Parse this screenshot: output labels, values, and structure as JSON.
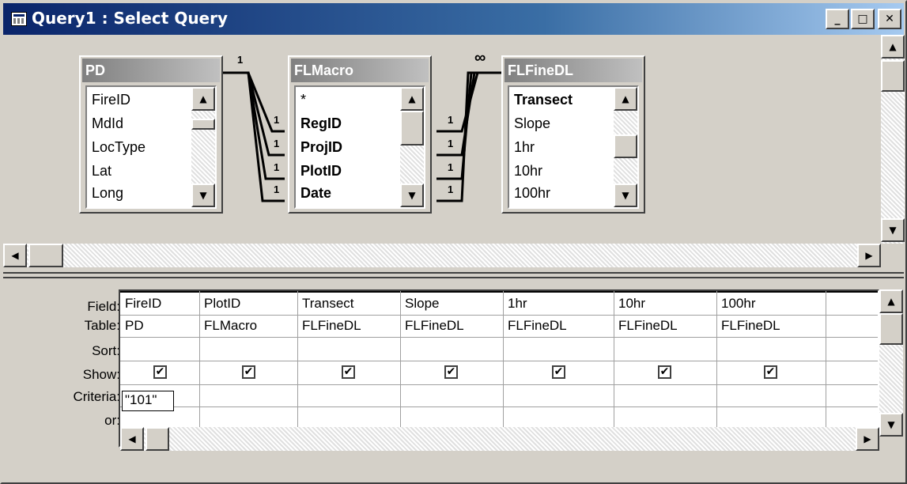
{
  "window": {
    "title": "Query1 : Select Query",
    "buttons": {
      "minimize": "_",
      "maximize": "□",
      "close": "✕"
    }
  },
  "tables": [
    {
      "name": "PD",
      "fields": [
        "FireID",
        "MdId",
        "LocType",
        "Lat",
        "Long"
      ],
      "bold_fields": []
    },
    {
      "name": "FLMacro",
      "fields": [
        "*",
        "RegID",
        "ProjID",
        "PlotID",
        "Date"
      ],
      "bold_fields": [
        "RegID",
        "ProjID",
        "PlotID",
        "Date"
      ]
    },
    {
      "name": "FLFineDL",
      "fields": [
        "Transect",
        "Slope",
        "1hr",
        "10hr",
        "100hr"
      ],
      "bold_fields": [
        "Transect"
      ]
    }
  ],
  "joins": {
    "pd_side": "1",
    "flmacro_left": [
      "1",
      "1",
      "1",
      "1"
    ],
    "flmacro_right": [
      "1",
      "1",
      "1",
      "1"
    ],
    "flfinedl_side": "∞"
  },
  "grid": {
    "row_labels": [
      "Field:",
      "Table:",
      "Sort:",
      "Show:",
      "Criteria:",
      "or:"
    ],
    "columns": [
      {
        "field": "FireID",
        "table": "PD",
        "sort": "",
        "show": true,
        "criteria": "\"101\""
      },
      {
        "field": "PlotID",
        "table": "FLMacro",
        "sort": "",
        "show": true,
        "criteria": ""
      },
      {
        "field": "Transect",
        "table": "FLFineDL",
        "sort": "",
        "show": true,
        "criteria": ""
      },
      {
        "field": "Slope",
        "table": "FLFineDL",
        "sort": "",
        "show": true,
        "criteria": ""
      },
      {
        "field": "1hr",
        "table": "FLFineDL",
        "sort": "",
        "show": true,
        "criteria": ""
      },
      {
        "field": "10hr",
        "table": "FLFineDL",
        "sort": "",
        "show": true,
        "criteria": ""
      },
      {
        "field": "100hr",
        "table": "FLFineDL",
        "sort": "",
        "show": true,
        "criteria": ""
      }
    ]
  },
  "icons": {
    "up_arrow": "▲",
    "down_arrow": "▼",
    "left_arrow": "◀",
    "right_arrow": "▶",
    "check": "✔"
  }
}
